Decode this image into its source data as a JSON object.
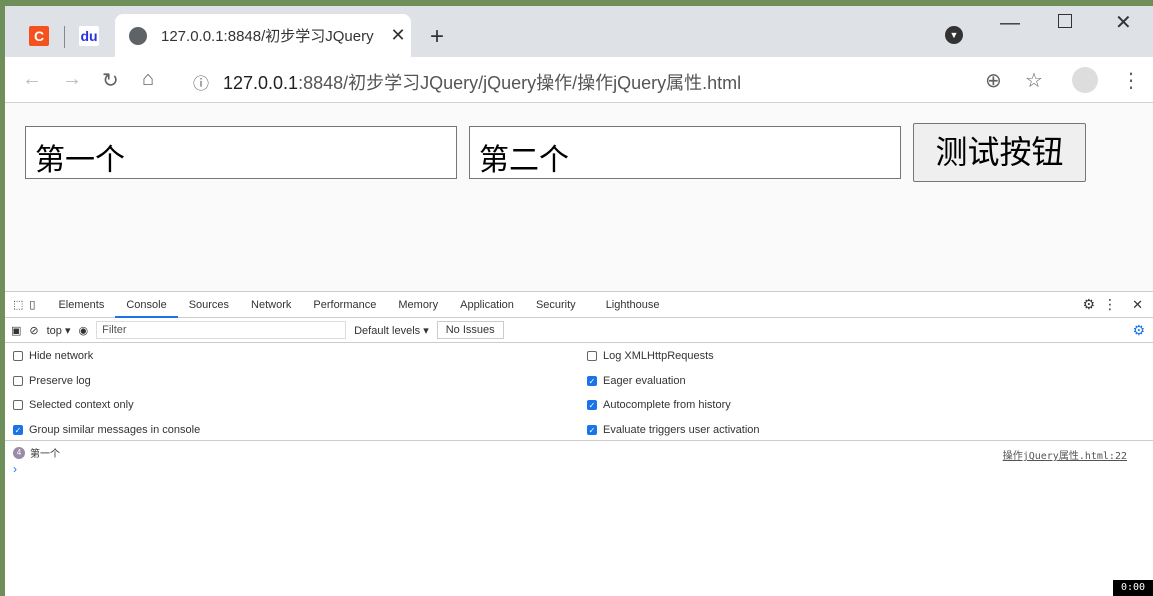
{
  "browser": {
    "tab_title": "127.0.0.1:8848/初步学习JQuery",
    "url_host": "127.0.0.1",
    "url_rest": ":8848/初步学习JQuery/jQuery操作/操作jQuery属性.html"
  },
  "page": {
    "input1": "第一个",
    "input2": "第二个",
    "button": "测试按钮"
  },
  "devtools": {
    "tabs": [
      "Elements",
      "Console",
      "Sources",
      "Network",
      "Performance",
      "Memory",
      "Application",
      "Security",
      "Lighthouse"
    ],
    "context": "top ▾",
    "filter_placeholder": "Filter",
    "levels": "Default levels ▾",
    "issues": "No Issues",
    "options_left": [
      {
        "label": "Hide network",
        "checked": false
      },
      {
        "label": "Preserve log",
        "checked": false
      },
      {
        "label": "Selected context only",
        "checked": false
      },
      {
        "label": "Group similar messages in console",
        "checked": true
      }
    ],
    "options_right": [
      {
        "label": "Log XMLHttpRequests",
        "checked": false
      },
      {
        "label": "Eager evaluation",
        "checked": true
      },
      {
        "label": "Autocomplete from history",
        "checked": true
      },
      {
        "label": "Evaluate triggers user activation",
        "checked": true
      }
    ],
    "message": {
      "count": "4",
      "text": "第一个",
      "source": "操作jQuery属性.html:22"
    }
  },
  "recorder": "0:00"
}
